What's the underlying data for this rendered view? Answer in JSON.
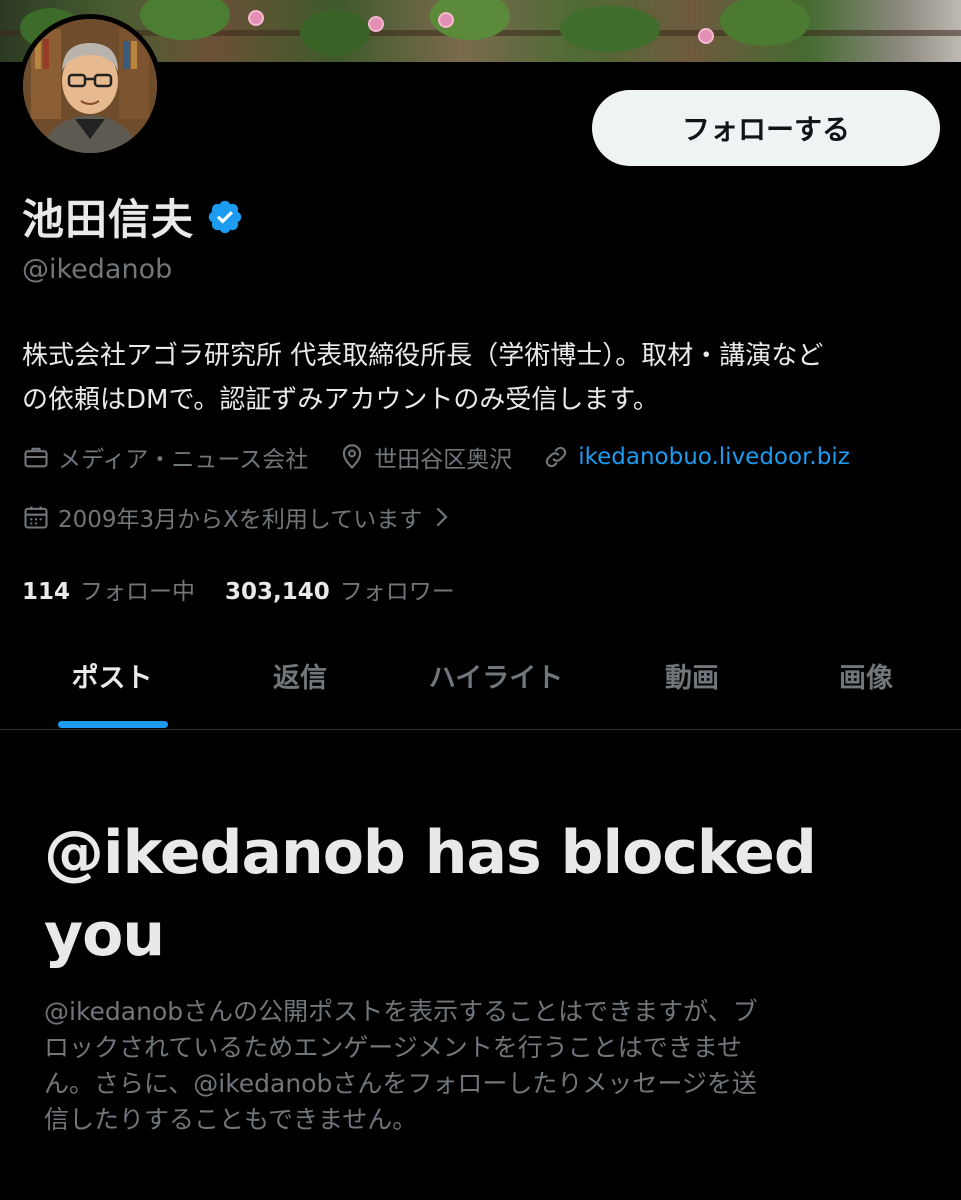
{
  "profile": {
    "follow_label": "フォローする",
    "display_name": "池田信夫",
    "handle": "@ikedanob",
    "bio_lines": [
      "株式会社アゴラ研究所 代表取締役所長（学術博士）。取材・講演など",
      "の依頼はDMで。認証ずみアカウントのみ受信します。"
    ],
    "category": "メディア・ニュース会社",
    "location": "世田谷区奥沢",
    "website": "ikedanobuo.livedoor.biz",
    "joined": "2009年3月からXを利用しています",
    "following_count": "114",
    "following_label": "フォロー中",
    "followers_count": "303,140",
    "followers_label": "フォロワー"
  },
  "tabs": [
    {
      "label": "ポスト",
      "active": true
    },
    {
      "label": "返信",
      "active": false
    },
    {
      "label": "ハイライト",
      "active": false
    },
    {
      "label": "動画",
      "active": false
    },
    {
      "label": "画像",
      "active": false
    }
  ],
  "blocked": {
    "title_lines": [
      "@ikedanob has blocked",
      "you"
    ],
    "description_lines": [
      "@ikedanobさんの公開ポストを表示することはできますが、ブ",
      "ロックされているためエンゲージメントを行うことはできませ",
      "ん。さらに、@ikedanobさんをフォローしたりメッセージを送",
      "信したりすることもできません。"
    ]
  },
  "colors": {
    "background": "#000000",
    "accent": "#1d9bf0",
    "secondary_text": "#71767b",
    "primary_text": "#e7e9ea",
    "button_bg": "#eff3f4"
  },
  "icons": [
    "briefcase-icon",
    "location-pin-icon",
    "link-icon",
    "calendar-icon",
    "chevron-right-icon",
    "verified-badge-icon"
  ]
}
